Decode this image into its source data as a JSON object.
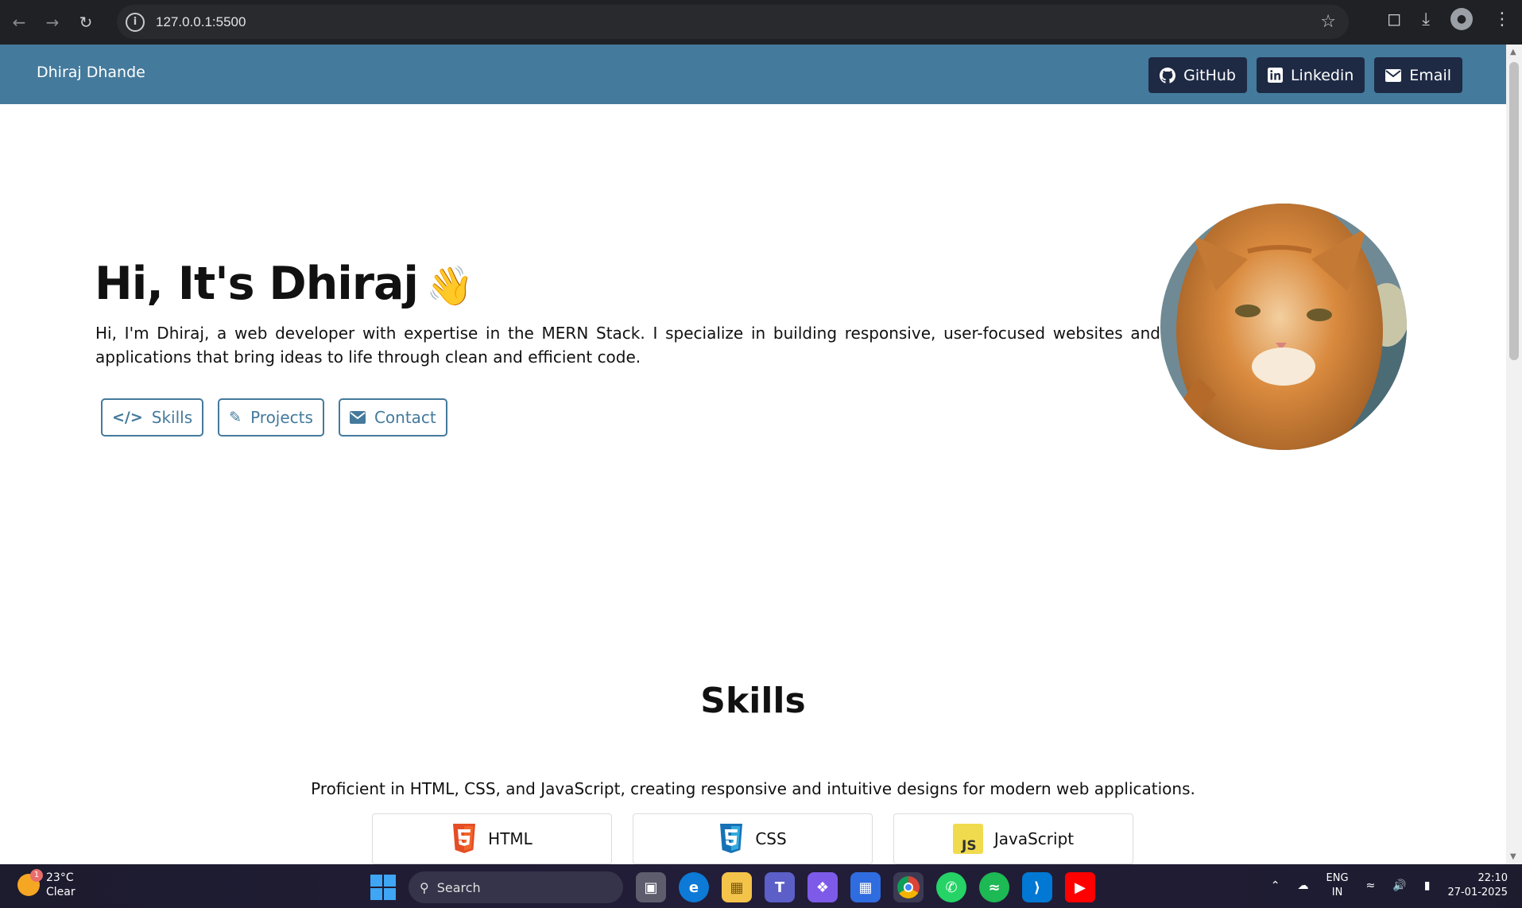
{
  "browser": {
    "url": "127.0.0.1:5500"
  },
  "site_nav": {
    "brand": "Dhiraj Dhande",
    "links": [
      {
        "label": "GitHub",
        "icon": "github-icon"
      },
      {
        "label": "Linkedin",
        "icon": "linkedin-icon"
      },
      {
        "label": "Email",
        "icon": "envelope-icon"
      }
    ]
  },
  "hero": {
    "title": "Hi, It's Dhiraj",
    "wave": "👋",
    "description": "Hi, I'm Dhiraj, a web developer with expertise in the MERN Stack. I specialize in building responsive, user-focused websites and applications that bring ideas to life through clean and efficient code.",
    "buttons": [
      {
        "label": "Skills",
        "icon": "code-icon"
      },
      {
        "label": "Projects",
        "icon": "pencil-icon"
      },
      {
        "label": "Contact",
        "icon": "envelope-icon"
      }
    ]
  },
  "skills": {
    "title": "Skills",
    "description": "Proficient in HTML, CSS, and JavaScript, creating responsive and intuitive designs for modern web applications.",
    "items": [
      {
        "label": "HTML",
        "icon": "html5-icon"
      },
      {
        "label": "CSS",
        "icon": "css3-icon"
      },
      {
        "label": "JavaScript",
        "icon": "js-icon"
      }
    ]
  },
  "taskbar": {
    "weather_temp": "23°C",
    "weather_cond": "Clear",
    "weather_badge": "1",
    "search_label": "Search",
    "lang_top": "ENG",
    "lang_bottom": "IN",
    "time": "22:10",
    "date": "27-01-2025"
  },
  "colors": {
    "navbar": "#447a9c",
    "nav_button": "#1e2a44",
    "accent": "#447a9c"
  }
}
